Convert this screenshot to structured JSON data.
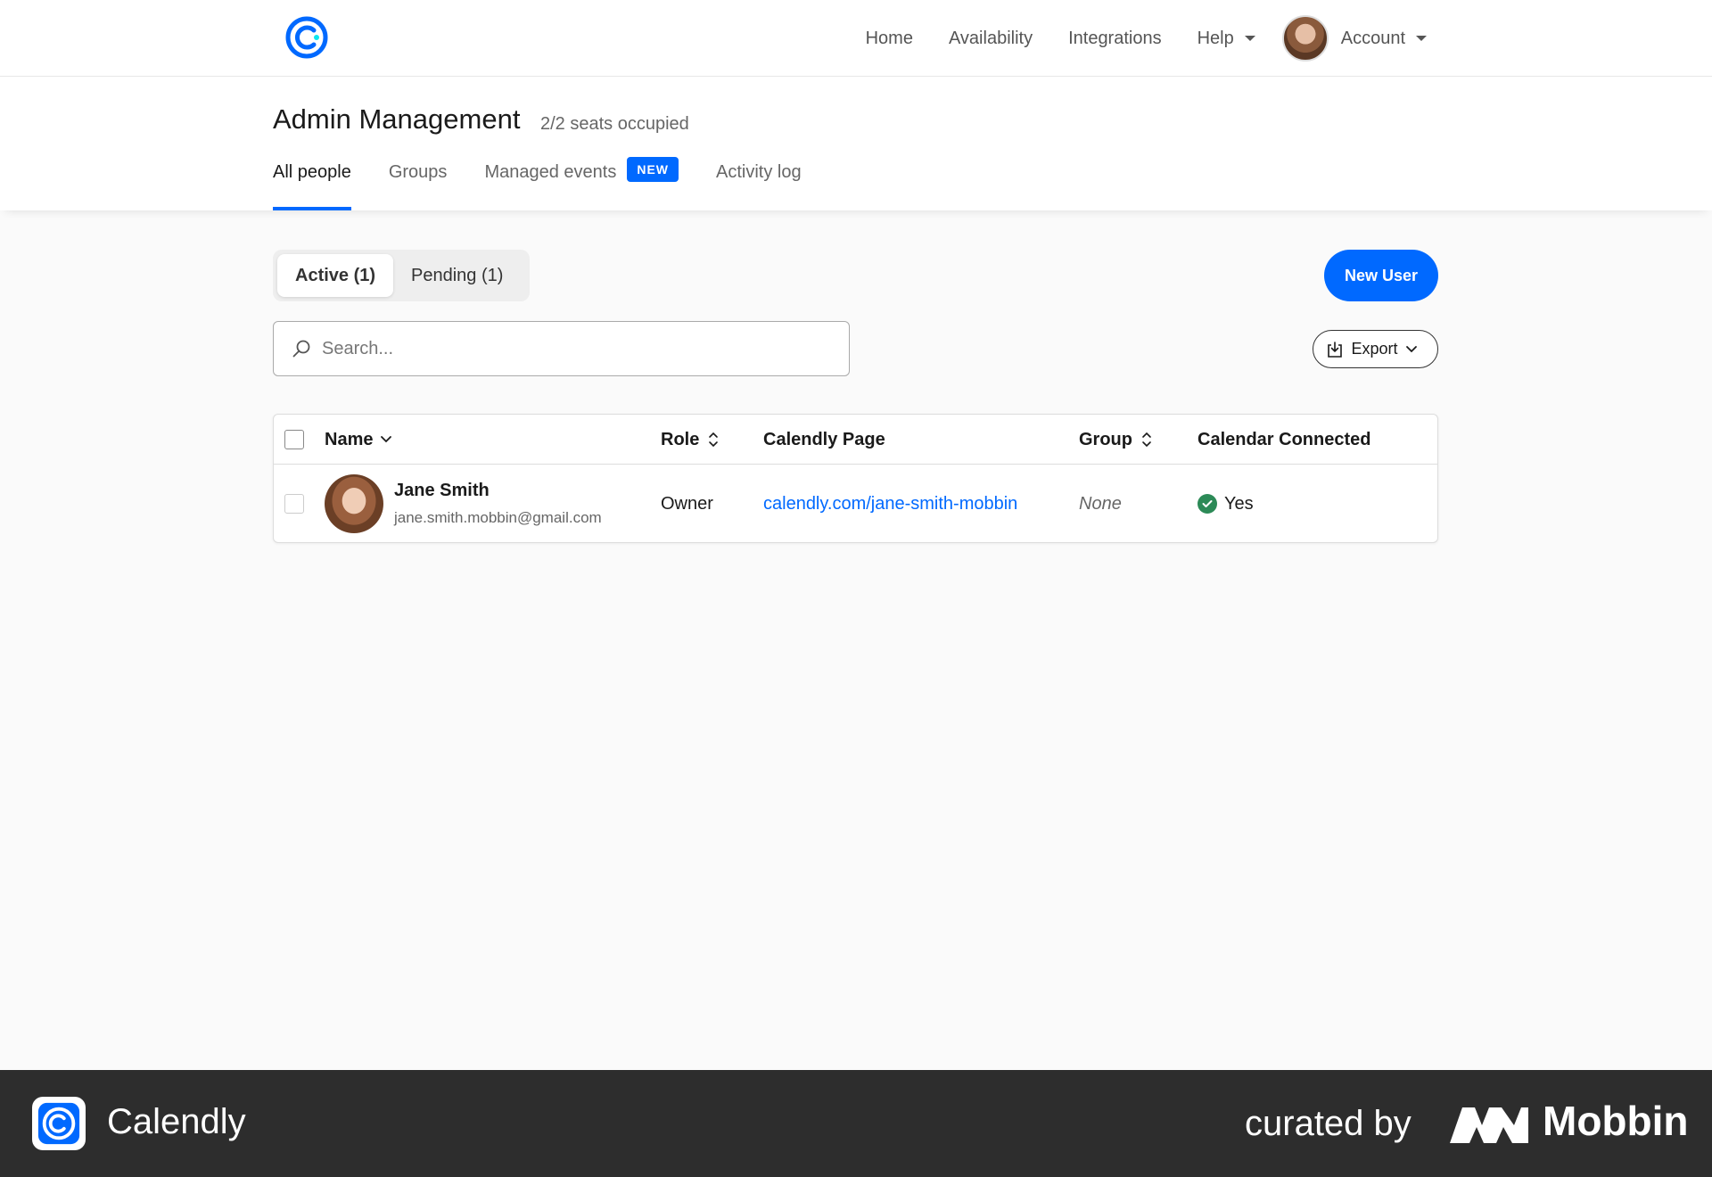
{
  "colors": {
    "brand": "#0069ff",
    "success": "#2c8a57",
    "footer_bg": "#2d2d2d"
  },
  "nav": {
    "logo_icon": "calendly-logo-icon",
    "links": [
      "Home",
      "Availability",
      "Integrations",
      "Help"
    ],
    "account_label": "Account"
  },
  "header": {
    "title": "Admin Management",
    "seats": "2/2 seats occupied",
    "tabs": [
      {
        "label": "All people",
        "active": true
      },
      {
        "label": "Groups"
      },
      {
        "label": "Managed events",
        "badge": "NEW"
      },
      {
        "label": "Activity log"
      }
    ]
  },
  "filters": {
    "active_label": "Active (1)",
    "pending_label": "Pending (1)",
    "new_user_label": "New User",
    "search_placeholder": "Search...",
    "export_label": "Export"
  },
  "table": {
    "columns": [
      "Name",
      "Role",
      "Calendly Page",
      "Group",
      "Calendar Connected"
    ],
    "rows": [
      {
        "name": "Jane Smith",
        "email": "jane.smith.mobbin@gmail.com",
        "role": "Owner",
        "page": "calendly.com/jane-smith-mobbin",
        "group": "None",
        "calendar": "Yes"
      }
    ]
  },
  "footer": {
    "brand": "Calendly",
    "curated": "curated by",
    "mobbin": "Mobbin"
  }
}
